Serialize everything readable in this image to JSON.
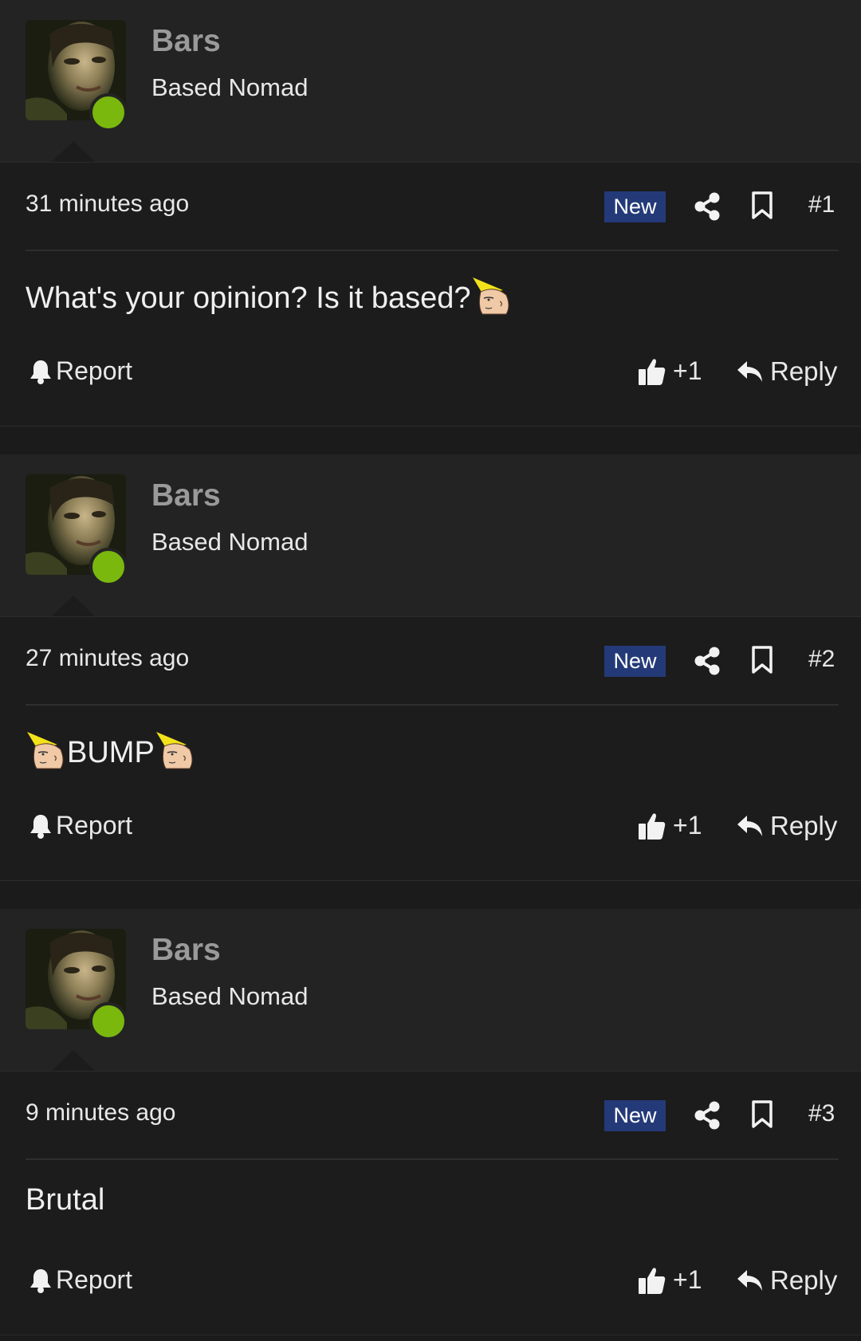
{
  "posts": [
    {
      "username": "Bars",
      "user_title": "Based Nomad",
      "timestamp": "31 minutes ago",
      "badge": "New",
      "post_number": "#1",
      "content_before": "What's your opinion? Is it based?",
      "content_after": "",
      "emote_before": false,
      "emote_after": true,
      "report_label": "Report",
      "like_count": "+1",
      "reply_label": "Reply"
    },
    {
      "username": "Bars",
      "user_title": "Based Nomad",
      "timestamp": "27 minutes ago",
      "badge": "New",
      "post_number": "#2",
      "content_before": "BUMP",
      "content_after": "",
      "emote_before": true,
      "emote_after": true,
      "report_label": "Report",
      "like_count": "+1",
      "reply_label": "Reply"
    },
    {
      "username": "Bars",
      "user_title": "Based Nomad",
      "timestamp": "9 minutes ago",
      "badge": "New",
      "post_number": "#3",
      "content_before": "Brutal",
      "content_after": "",
      "emote_before": false,
      "emote_after": false,
      "report_label": "Report",
      "like_count": "+1",
      "reply_label": "Reply"
    }
  ],
  "colors": {
    "online": "#7ab80e",
    "badge_bg": "#243a78",
    "header_bg": "#232323",
    "body_bg": "#1c1c1c"
  },
  "icons": {
    "share": "share-icon",
    "bookmark": "bookmark-icon",
    "report": "bell-icon",
    "like": "thumbs-up-icon",
    "reply": "reply-arrow-icon",
    "emote": "chad-face-emote"
  }
}
